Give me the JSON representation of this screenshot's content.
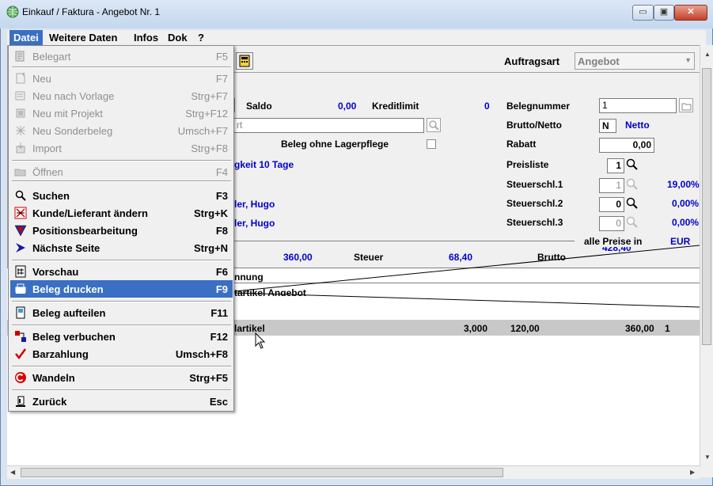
{
  "window": {
    "title": "Einkauf / Faktura - Angebot Nr. 1",
    "min_glyph": "▭",
    "max_glyph": "▣",
    "close_glyph": "✕"
  },
  "menubar": [
    "Datei",
    "Weitere Daten",
    "Infos",
    "Dok",
    "?"
  ],
  "dropdown": {
    "items": [
      {
        "label": "Belegart",
        "shortcut": "F5",
        "icon": "document-type-icon",
        "enabled": false
      },
      {
        "label": "Neu",
        "shortcut": "F7",
        "icon": "new-document-icon",
        "enabled": false
      },
      {
        "label": "Neu nach Vorlage",
        "shortcut": "Strg+F7",
        "icon": "template-icon",
        "enabled": false
      },
      {
        "label": "Neu mit Projekt",
        "shortcut": "Strg+F12",
        "icon": "project-icon",
        "enabled": false
      },
      {
        "label": "Neu Sonderbeleg",
        "shortcut": "Umsch+F7",
        "icon": "special-document-icon",
        "enabled": false
      },
      {
        "label": "Import",
        "shortcut": "Strg+F8",
        "icon": "import-icon",
        "enabled": false
      },
      {
        "label": "Öffnen",
        "shortcut": "F4",
        "icon": "folder-open-icon",
        "enabled": false
      },
      {
        "label": "Suchen",
        "shortcut": "F3",
        "icon": "search-icon",
        "enabled": true
      },
      {
        "label": "Kunde/Lieferant ändern",
        "shortcut": "Strg+K",
        "icon": "customer-change-icon",
        "enabled": true
      },
      {
        "label": "Positionsbearbeitung",
        "shortcut": "F8",
        "icon": "funnel-icon",
        "enabled": true
      },
      {
        "label": "Nächste Seite",
        "shortcut": "Strg+N",
        "icon": "arrow-right-icon",
        "enabled": true
      },
      {
        "label": "Vorschau",
        "shortcut": "F6",
        "icon": "preview-icon",
        "enabled": true
      },
      {
        "label": "Beleg drucken",
        "shortcut": "F9",
        "icon": "printer-icon",
        "enabled": true,
        "highlighted": true
      },
      {
        "label": "Beleg aufteilen",
        "shortcut": "F11",
        "icon": "split-icon",
        "enabled": true
      },
      {
        "label": "Beleg verbuchen",
        "shortcut": "F12",
        "icon": "post-document-icon",
        "enabled": true
      },
      {
        "label": "Barzahlung",
        "shortcut": "Umsch+F8",
        "icon": "checkmark-icon",
        "enabled": true
      },
      {
        "label": "Wandeln",
        "shortcut": "Strg+F5",
        "icon": "convert-icon",
        "enabled": true
      },
      {
        "label": "Zurück",
        "shortcut": "Esc",
        "icon": "back-icon",
        "enabled": true
      }
    ]
  },
  "form": {
    "auftragsart_label": "Auftragsart",
    "auftragsart_value": "Angebot",
    "saldo_label": "Saldo",
    "saldo_value": "0,00",
    "kreditlimit_label": "Kreditlimit",
    "kreditlimit_value": "0",
    "belegnummer_label": "Belegnummer",
    "belegnummer_value": "1",
    "partial_field_text": "rt",
    "brutto_netto_label": "Brutto/Netto",
    "brutto_netto_value": "N",
    "brutto_netto_text": "Netto",
    "beleg_ohne_lager_label": "Beleg ohne Lagerpflege",
    "rabatt_label": "Rabatt",
    "rabatt_value": "0,00",
    "zahlung_partial": "gkeit 10 Tage",
    "preisliste_label": "Preisliste",
    "preisliste_value": "1",
    "steuer1_label": "Steuerschl.1",
    "steuer1_value": "1",
    "steuer1_pct": "19,00%",
    "steuer2_label": "Steuerschl.2",
    "steuer2_value": "0",
    "steuer2_pct": "0,00%",
    "steuer3_label": "Steuerschl.3",
    "steuer3_value": "0",
    "steuer3_pct": "0,00%",
    "contact1_partial": "ler, Hugo",
    "contact2_partial": "ler, Hugo",
    "alle_preise_label": "alle Preise in",
    "currency": "EUR",
    "netto_total": "360,00",
    "steuer_label": "Steuer",
    "steuer_total": "68,40",
    "brutto_label": "Brutto",
    "brutto_total": "428,40"
  },
  "list": {
    "header": "nnung",
    "rows": [
      {
        "text": "tartikel Angebot"
      },
      {
        "text": "lartikel",
        "qty": "3,000",
        "price": "120,00",
        "total": "360,00",
        "flag": "1"
      }
    ]
  }
}
